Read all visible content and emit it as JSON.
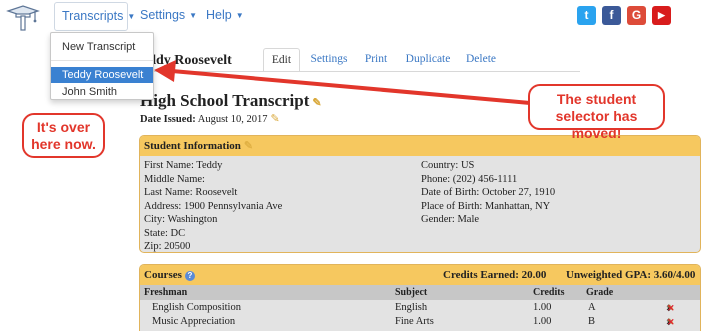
{
  "nav": {
    "logo_icon": "mortarboard-t-icon",
    "transcripts_label": "Transcripts",
    "settings_label": "Settings",
    "help_label": "Help",
    "social": [
      "twitter-icon",
      "facebook-icon",
      "google-icon",
      "youtube-icon"
    ],
    "social_glyphs": {
      "twitter": "t",
      "facebook": "f",
      "google": "G",
      "youtube": "▶"
    }
  },
  "dropdown": {
    "new_transcript": "New Transcript",
    "students": [
      {
        "name": "Teddy Roosevelt",
        "selected": true
      },
      {
        "name": "John Smith",
        "selected": false
      }
    ]
  },
  "header": {
    "student_name": "eddy Roosevelt",
    "tabs": [
      {
        "label": "Edit",
        "active": true
      },
      {
        "label": "Settings"
      },
      {
        "label": "Print"
      },
      {
        "label": "Duplicate"
      },
      {
        "label": "Delete"
      }
    ]
  },
  "document": {
    "title": "High School Transcript",
    "date_issued_label": "Date Issued:",
    "date_issued_value": "August 10, 2017"
  },
  "student_info": {
    "heading": "Student Information",
    "left": [
      "First Name: Teddy",
      "Middle Name:",
      "Last Name: Roosevelt",
      "Address: 1900 Pennsylvania Ave",
      "City: Washington",
      "State: DC",
      "Zip: 20500"
    ],
    "right": [
      "Country: US",
      "Phone: (202) 456-1111",
      "Date of Birth: October 27, 1910",
      "Place of Birth: Manhattan, NY",
      "Gender: Male"
    ]
  },
  "courses": {
    "heading": "Courses",
    "credits_earned_label": "Credits Earned:",
    "credits_earned_value": "20.00",
    "gpa_label": "Unweighted GPA:",
    "gpa_value": "3.60/4.00",
    "year": "Freshman",
    "columns": {
      "subject": "Subject",
      "credits": "Credits",
      "grade": "Grade"
    },
    "rows": [
      {
        "course": "English Composition",
        "subject": "English",
        "credits": "1.00",
        "grade": "A"
      },
      {
        "course": "Music Appreciation",
        "subject": "Fine Arts",
        "credits": "1.00",
        "grade": "B"
      }
    ]
  },
  "annotations": {
    "moved": "The student selector has moved!",
    "over_here": "It's over here now.",
    "color": "#e2362b"
  }
}
